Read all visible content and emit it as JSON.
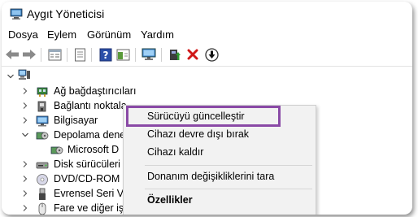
{
  "window": {
    "title": "Aygıt Yöneticisi"
  },
  "menu": [
    "Dosya",
    "Eylem",
    "Görünüm",
    "Yardım"
  ],
  "toolbar": [
    {
      "icon": "back-arrow-icon"
    },
    {
      "icon": "forward-arrow-icon"
    },
    {
      "icon": "properties-icon"
    },
    {
      "icon": "document-icon"
    },
    {
      "icon": "help-icon"
    },
    {
      "icon": "action-pane-icon"
    },
    {
      "icon": "monitor-icon"
    },
    {
      "icon": "update-driver-icon"
    },
    {
      "icon": "uninstall-x-icon"
    },
    {
      "icon": "download-icon"
    }
  ],
  "tree": {
    "items": [
      {
        "label": "Ağ bağdaştırıcıları",
        "icon": "network-adapter-icon",
        "expander": "collapsed"
      },
      {
        "label": "Bağlantı noktala",
        "icon": "port-icon",
        "expander": "collapsed"
      },
      {
        "label": "Bilgisayar",
        "icon": "computer-icon",
        "expander": "collapsed"
      },
      {
        "label": "Depolama dene",
        "icon": "storage-icon",
        "expander": "expanded"
      },
      {
        "label": "Microsoft D",
        "icon": "storage-child-icon",
        "expander": "none"
      },
      {
        "label": "Disk sürücüleri",
        "icon": "disk-drive-icon",
        "expander": "collapsed"
      },
      {
        "label": "DVD/CD-ROM s",
        "icon": "dvd-drive-icon",
        "expander": "collapsed"
      },
      {
        "label": "Evrensel Seri Ver",
        "icon": "usb-icon",
        "expander": "collapsed"
      },
      {
        "label": "Fare ve diğer işa",
        "icon": "mouse-icon",
        "expander": "collapsed"
      }
    ]
  },
  "context_menu": {
    "items": [
      {
        "label": "Sürücüyü güncelleştir"
      },
      {
        "label": "Cihazı devre dışı bırak"
      },
      {
        "label": "Cihazı kaldır"
      },
      {
        "label": "Donanım değişikliklerini tara"
      },
      {
        "label": "Özellikler",
        "bold": true
      }
    ]
  },
  "colors": {
    "highlight": "#8a4aa6",
    "accent": "#1e62c8",
    "danger": "#d01818"
  }
}
